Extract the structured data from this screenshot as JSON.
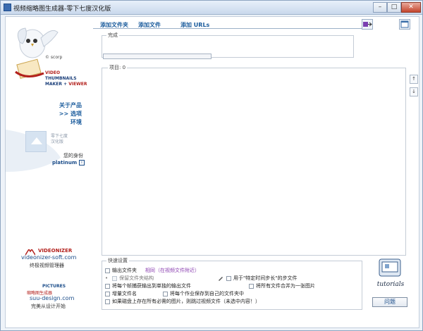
{
  "window": {
    "title": "视频缩略图生成器-零下七度汉化版",
    "controls": {
      "minimize": "–",
      "maximize": "□",
      "close": "✕"
    }
  },
  "sidebar": {
    "logo": {
      "scorp": "© scorp",
      "line1": "VIDEO",
      "line2": "THUMBNAILS",
      "line3a": "MAKER + ",
      "line3b": "VIEWER"
    },
    "nav": [
      "关于产品",
      ">> 选项",
      "环境"
    ],
    "thumb_caption": [
      "零下七度",
      "汉化版"
    ],
    "identity_label": "您的身份",
    "identity_value": "platinum",
    "info_icon": "i",
    "videonizer": {
      "brand": "VIDEONIZER",
      "url": "videonizer-soft.com",
      "desc": "终极视频管理器"
    },
    "pictures": {
      "brand": "PICTURES",
      "sub": "缩略图生成器",
      "url": "suu-design.com",
      "desc": "完美从设计开始"
    }
  },
  "toolbar": {
    "add_folder": "添加文件夹",
    "add_file": "添加文件",
    "add_urls": "添加 URLs",
    "export_icon": "export-icon",
    "window_icon": "window-icon"
  },
  "progress": {
    "label": "完成",
    "value": 0
  },
  "items": {
    "label": "项目: 0",
    "up": "↑",
    "down": "↓"
  },
  "quick": {
    "label": "快速设置",
    "output_folder": "输出文件夹",
    "output_folder_value": "相同（在视频文件附近）",
    "keep_structure": "保留文件夹结构",
    "bitmap_step": "用于\"特定时间步长\"的步文件",
    "extract_each": "将每个帧捕获输出到单独的输出文件",
    "merge_all": "将所有文件合并为一张图片",
    "increment_name": "增量文件名",
    "save_own_folder": "将每个作业保存到自己的文件夹中",
    "skip_existing": "如果磁盘上存在所有必需的图片，则跳过视频文件（未选中内容！）"
  },
  "tutorials": "tutorials",
  "help_button": "问题"
}
